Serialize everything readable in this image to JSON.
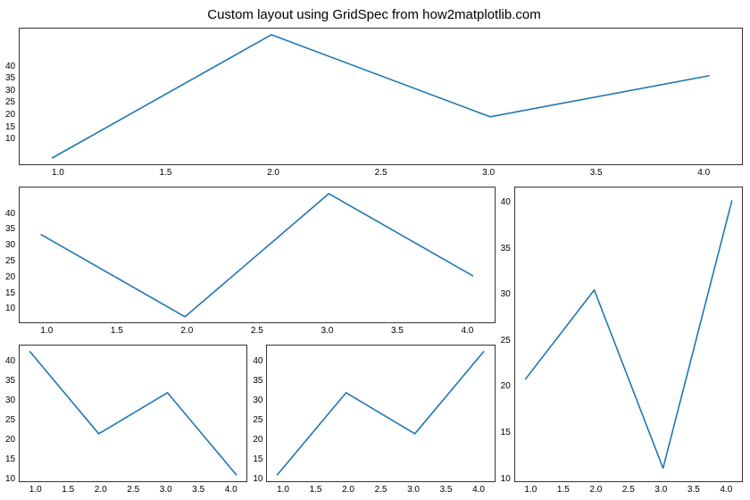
{
  "title": "Custom layout using GridSpec from how2matplotlib.com",
  "yticks": [
    "40",
    "35",
    "30",
    "25",
    "20",
    "15",
    "10"
  ],
  "xticks_coarse": [
    "1.0",
    "1.5",
    "2.0",
    "2.5",
    "3.0",
    "3.5",
    "4.0"
  ],
  "xticks_fine": [
    "1.0",
    "1.5",
    "2.0",
    "2.5",
    "3.0",
    "3.5",
    "4.0"
  ],
  "chart_data": [
    {
      "id": "a",
      "type": "line",
      "title": "",
      "xlabel": "",
      "ylabel": "",
      "x": [
        1,
        2,
        3,
        4
      ],
      "values": [
        10,
        40,
        20,
        30
      ],
      "xticks": [
        1.0,
        1.5,
        2.0,
        2.5,
        3.0,
        3.5,
        4.0
      ],
      "yticks": [
        10,
        15,
        20,
        25,
        30,
        35,
        40
      ],
      "xlim": [
        0.85,
        4.15
      ],
      "ylim": [
        8.5,
        41.5
      ]
    },
    {
      "id": "b",
      "type": "line",
      "title": "",
      "xlabel": "",
      "ylabel": "",
      "x": [
        1,
        2,
        3,
        4
      ],
      "values": [
        30,
        10,
        40,
        20
      ],
      "xticks": [
        1.0,
        1.5,
        2.0,
        2.5,
        3.0,
        3.5,
        4.0
      ],
      "yticks": [
        10,
        15,
        20,
        25,
        30,
        35,
        40
      ],
      "xlim": [
        0.85,
        4.15
      ],
      "ylim": [
        8.5,
        41.5
      ]
    },
    {
      "id": "c",
      "type": "line",
      "title": "",
      "xlabel": "",
      "ylabel": "",
      "x": [
        1,
        2,
        3,
        4
      ],
      "values": [
        20,
        30,
        10,
        40
      ],
      "xticks": [
        1.0,
        1.5,
        2.0,
        2.5,
        3.0,
        3.5,
        4.0
      ],
      "yticks": [
        10,
        15,
        20,
        25,
        30,
        35,
        40
      ],
      "xlim": [
        0.85,
        4.15
      ],
      "ylim": [
        8.5,
        41.5
      ]
    },
    {
      "id": "d",
      "type": "line",
      "title": "",
      "xlabel": "",
      "ylabel": "",
      "x": [
        1,
        2,
        3,
        4
      ],
      "values": [
        40,
        20,
        30,
        10
      ],
      "xticks": [
        1.0,
        1.5,
        2.0,
        2.5,
        3.0,
        3.5,
        4.0
      ],
      "yticks": [
        10,
        15,
        20,
        25,
        30,
        35,
        40
      ],
      "xlim": [
        0.85,
        4.15
      ],
      "ylim": [
        8.5,
        41.5
      ]
    },
    {
      "id": "e",
      "type": "line",
      "title": "",
      "xlabel": "",
      "ylabel": "",
      "x": [
        1,
        2,
        3,
        4
      ],
      "values": [
        10,
        30,
        20,
        40
      ],
      "xticks": [
        1.0,
        1.5,
        2.0,
        2.5,
        3.0,
        3.5,
        4.0
      ],
      "yticks": [
        10,
        15,
        20,
        25,
        30,
        35,
        40
      ],
      "xlim": [
        0.85,
        4.15
      ],
      "ylim": [
        8.5,
        41.5
      ]
    }
  ]
}
